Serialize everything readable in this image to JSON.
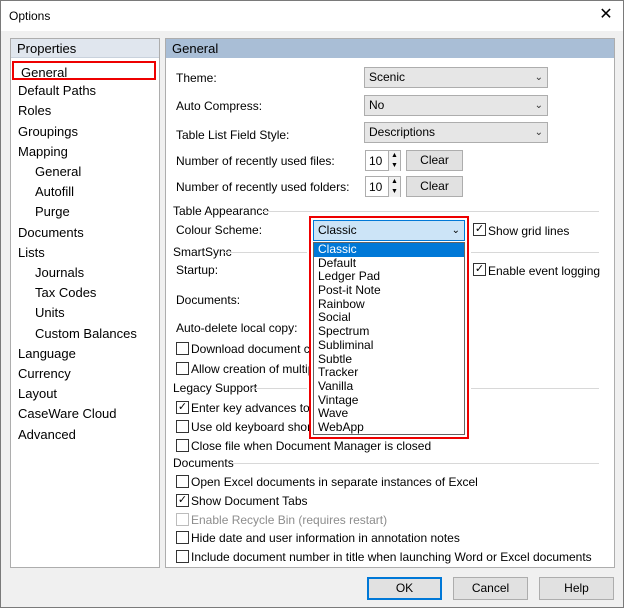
{
  "window": {
    "title": "Options",
    "close_glyph": "✕"
  },
  "nav": {
    "header": "Properties",
    "items": [
      {
        "label": "General",
        "indent": 0
      },
      {
        "label": "Default Paths",
        "indent": 0
      },
      {
        "label": "Roles",
        "indent": 0
      },
      {
        "label": "Groupings",
        "indent": 0
      },
      {
        "label": "Mapping",
        "indent": 0
      },
      {
        "label": "General",
        "indent": 1
      },
      {
        "label": "Autofill",
        "indent": 1
      },
      {
        "label": "Purge",
        "indent": 1
      },
      {
        "label": "Documents",
        "indent": 0
      },
      {
        "label": "Lists",
        "indent": 0
      },
      {
        "label": "Journals",
        "indent": 1
      },
      {
        "label": "Tax Codes",
        "indent": 1
      },
      {
        "label": "Units",
        "indent": 1
      },
      {
        "label": "Custom Balances",
        "indent": 1
      },
      {
        "label": "Language",
        "indent": 0
      },
      {
        "label": "Currency",
        "indent": 0
      },
      {
        "label": "Layout",
        "indent": 0
      },
      {
        "label": "CaseWare Cloud",
        "indent": 0
      },
      {
        "label": "Advanced",
        "indent": 0
      }
    ]
  },
  "general": {
    "header": "General",
    "theme_label": "Theme:",
    "theme_value": "Scenic",
    "auto_compress_label": "Auto Compress:",
    "auto_compress_value": "No",
    "table_style_label": "Table List Field Style:",
    "table_style_value": "Descriptions",
    "recent_files_label": "Number of recently used files:",
    "recent_files_value": "10",
    "recent_folders_label": "Number of recently used folders:",
    "recent_folders_value": "10",
    "clear_label": "Clear"
  },
  "table_appearance": {
    "section": "Table Appearance",
    "colour_scheme_label": "Colour Scheme:",
    "colour_scheme_value": "Classic",
    "show_grid_lines": "Show grid lines",
    "options": [
      "Classic",
      "Default",
      "Ledger Pad",
      "Post-it Note",
      "Rainbow",
      "Social",
      "Spectrum",
      "Subliminal",
      "Subtle",
      "Tracker",
      "Vanilla",
      "Vintage",
      "Wave",
      "WebApp"
    ]
  },
  "smartsync": {
    "section": "SmartSync",
    "startup_label": "Startup:",
    "documents_label": "Documents:",
    "enable_event_logging": "Enable event logging",
    "auto_delete_label": "Auto-delete local copy:",
    "download_doc": "Download document cha",
    "allow_creation": "Allow creation of multipl"
  },
  "legacy": {
    "section": "Legacy Support",
    "enter_key": "Enter key advances to the",
    "old_keyboard": "Use old keyboard shortcu",
    "close_file": "Close file when Document Manager is closed"
  },
  "documents": {
    "section": "Documents",
    "open_excel": "Open Excel documents in separate instances of Excel",
    "show_tabs": "Show Document Tabs",
    "recycle_bin": "Enable Recycle Bin (requires restart)",
    "hide_date": "Hide date and user information in annotation notes",
    "include_docnum": "Include document number in title when launching Word or Excel documents"
  },
  "buttons": {
    "ok": "OK",
    "cancel": "Cancel",
    "help": "Help"
  },
  "glyphs": {
    "check": "✓",
    "arrow_down": "⌄",
    "spin_up": "▲",
    "spin_down": "▼"
  }
}
